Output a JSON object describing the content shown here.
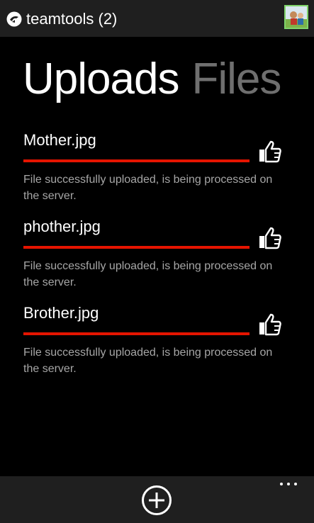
{
  "app": {
    "title": "teamtools (2)",
    "logo_icon": "teamtools-logo-icon",
    "avatar_icon": "user-avatar"
  },
  "pivot": {
    "tabs": [
      {
        "label": "Uploads",
        "active": true
      },
      {
        "label": "Files",
        "active": false
      }
    ]
  },
  "uploads": [
    {
      "file_name": "Mother.jpg",
      "progress": 1.0,
      "status": "File successfully uploaded, is being processed on the server.",
      "action_icon": "thumbs-up-icon"
    },
    {
      "file_name": "phother.jpg",
      "progress": 1.0,
      "status": "File successfully uploaded, is being processed on the server.",
      "action_icon": "thumbs-up-icon"
    },
    {
      "file_name": "Brother.jpg",
      "progress": 1.0,
      "status": "File successfully uploaded, is being processed on the server.",
      "action_icon": "thumbs-up-icon"
    }
  ],
  "appbar": {
    "add_icon": "add-circle-icon",
    "more_icon": "ellipsis-icon"
  },
  "colors": {
    "accent": "#e51400",
    "background": "#000000",
    "chrome": "#1f1f1f",
    "inactive_tab": "#6f6f6f",
    "secondary_text": "#a6a6a6"
  }
}
